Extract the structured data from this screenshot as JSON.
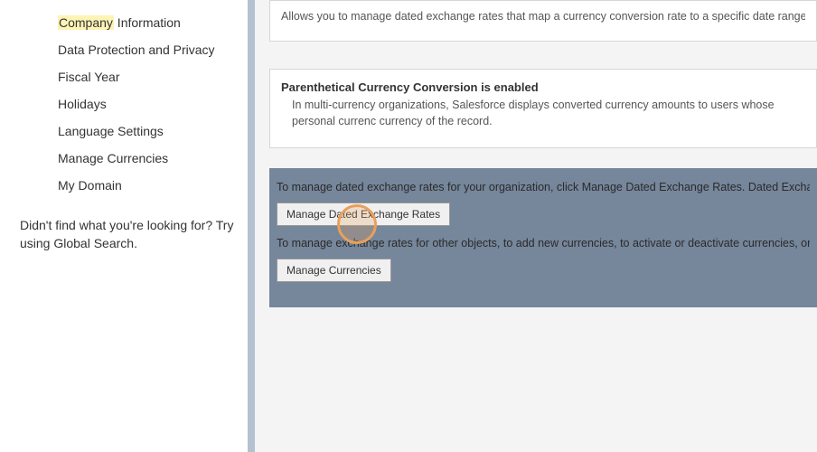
{
  "sidebar": {
    "items": [
      {
        "label_prefix": "Company",
        "label_rest": " Information",
        "highlighted": true
      },
      {
        "label": "Data Protection and Privacy"
      },
      {
        "label": "Fiscal Year"
      },
      {
        "label": "Holidays"
      },
      {
        "label": "Language Settings"
      },
      {
        "label": "Manage Currencies"
      },
      {
        "label": "My Domain"
      }
    ],
    "help_text": "Didn't find what you're looking for? Try using Global Search."
  },
  "main": {
    "info1_text": "Allows you to manage dated exchange rates that map a currency conversion rate to a specific date range. For mor",
    "info2_title": "Parenthetical Currency Conversion is enabled",
    "info2_text": "In multi-currency organizations, Salesforce displays converted currency amounts to users whose personal currenc currency of the record.",
    "action_line1": "To manage dated exchange rates for your organization, click Manage Dated Exchange Rates. Dated Exchange Rates a",
    "btn1_label": "Manage Dated Exchange Rates",
    "action_line2": "To manage exchange rates for other objects, to add new currencies, to activate or deactivate currencies, or to change t",
    "btn2_label": "Manage Currencies"
  }
}
